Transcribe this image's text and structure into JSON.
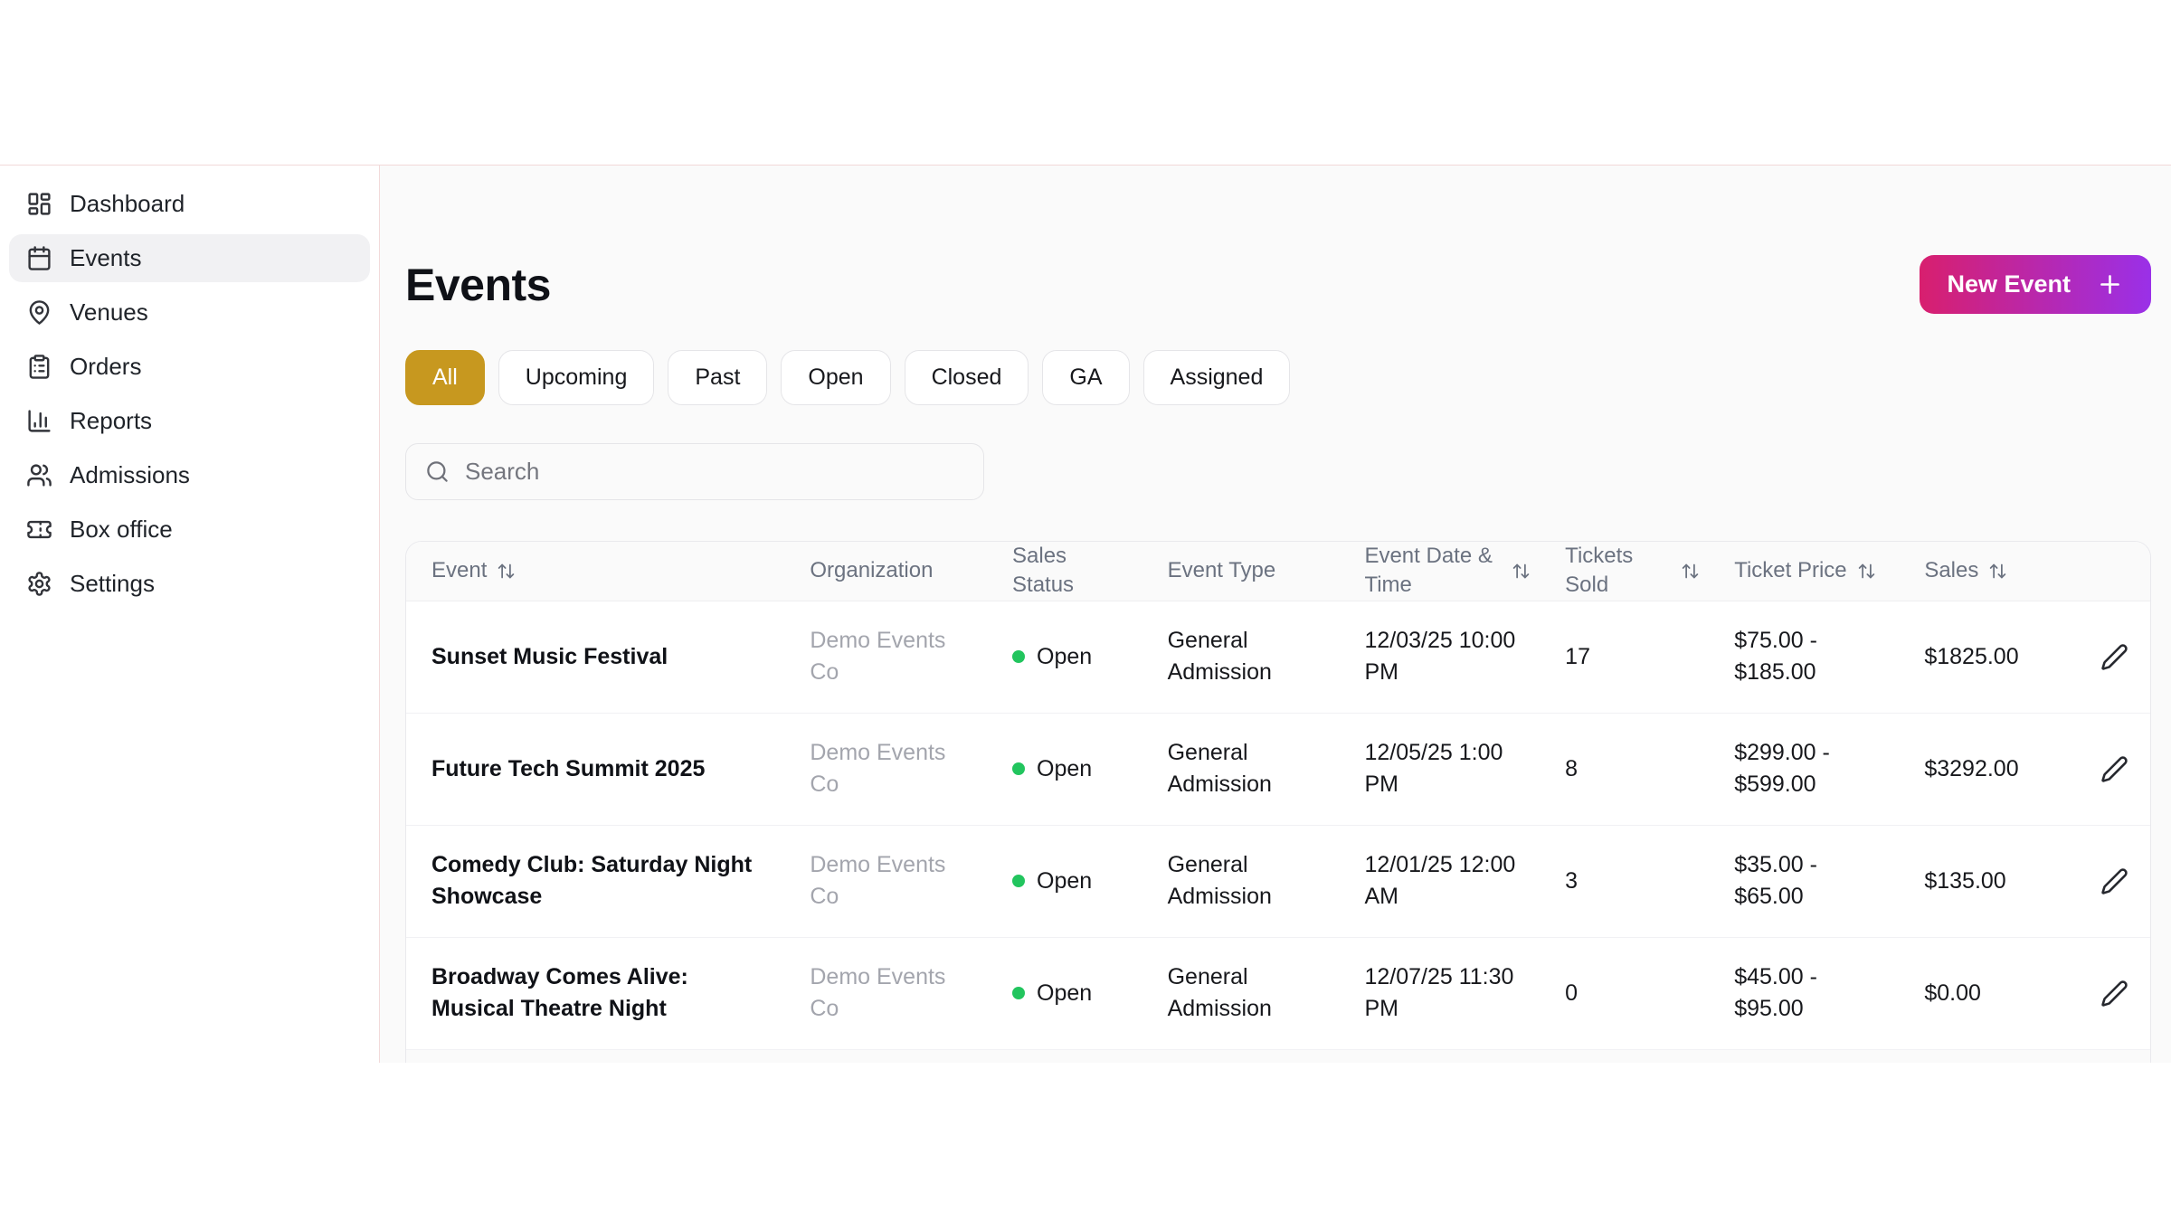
{
  "colors": {
    "frame_line": "#f2d9d9",
    "main_background": "#fafafa",
    "active_chip_gold": "#c7981f",
    "button_gradient_start": "#d81f6e",
    "button_gradient_end": "#9a30e8",
    "status_open_green": "#22c55e"
  },
  "sidebar": {
    "items": [
      {
        "label": "Dashboard",
        "icon": "dashboard-icon",
        "active": false
      },
      {
        "label": "Events",
        "icon": "calendar-icon",
        "active": true
      },
      {
        "label": "Venues",
        "icon": "map-pin-icon",
        "active": false
      },
      {
        "label": "Orders",
        "icon": "clipboard-list-icon",
        "active": false
      },
      {
        "label": "Reports",
        "icon": "bar-chart-icon",
        "active": false
      },
      {
        "label": "Admissions",
        "icon": "users-icon",
        "active": false
      },
      {
        "label": "Box office",
        "icon": "ticket-icon",
        "active": false
      },
      {
        "label": "Settings",
        "icon": "gear-icon",
        "active": false
      }
    ]
  },
  "header": {
    "title": "Events",
    "new_event_label": "New Event"
  },
  "filters": [
    {
      "label": "All",
      "active": true
    },
    {
      "label": "Upcoming",
      "active": false
    },
    {
      "label": "Past",
      "active": false
    },
    {
      "label": "Open",
      "active": false
    },
    {
      "label": "Closed",
      "active": false
    },
    {
      "label": "GA",
      "active": false
    },
    {
      "label": "Assigned",
      "active": false
    }
  ],
  "search": {
    "placeholder": "Search"
  },
  "table": {
    "columns": [
      {
        "label": "Event",
        "sortable": true
      },
      {
        "label": "Organization",
        "sortable": false
      },
      {
        "label": "Sales Status",
        "sortable": false
      },
      {
        "label": "Event Type",
        "sortable": false
      },
      {
        "label": "Event Date & Time",
        "sortable": true
      },
      {
        "label": "Tickets Sold",
        "sortable": true
      },
      {
        "label": "Ticket Price",
        "sortable": true
      },
      {
        "label": "Sales",
        "sortable": true
      }
    ],
    "rows": [
      {
        "event": "Sunset Music Festival",
        "organization": "Demo Events Co",
        "sales_status": "Open",
        "event_type": "General Admission",
        "event_datetime": "12/03/25 10:00 PM",
        "tickets_sold": "17",
        "ticket_price": "$75.00 - $185.00",
        "sales": "$1825.00"
      },
      {
        "event": "Future Tech Summit 2025",
        "organization": "Demo Events Co",
        "sales_status": "Open",
        "event_type": "General Admission",
        "event_datetime": "12/05/25 1:00 PM",
        "tickets_sold": "8",
        "ticket_price": "$299.00 - $599.00",
        "sales": "$3292.00"
      },
      {
        "event": "Comedy Club: Saturday Night Showcase",
        "organization": "Demo Events Co",
        "sales_status": "Open",
        "event_type": "General Admission",
        "event_datetime": "12/01/25 12:00 AM",
        "tickets_sold": "3",
        "ticket_price": "$35.00 - $65.00",
        "sales": "$135.00"
      },
      {
        "event": "Broadway Comes Alive: Musical Theatre Night",
        "organization": "Demo Events Co",
        "sales_status": "Open",
        "event_type": "General Admission",
        "event_datetime": "12/07/25 11:30 PM",
        "tickets_sold": "0",
        "ticket_price": "$45.00 - $95.00",
        "sales": "$0.00"
      }
    ]
  }
}
